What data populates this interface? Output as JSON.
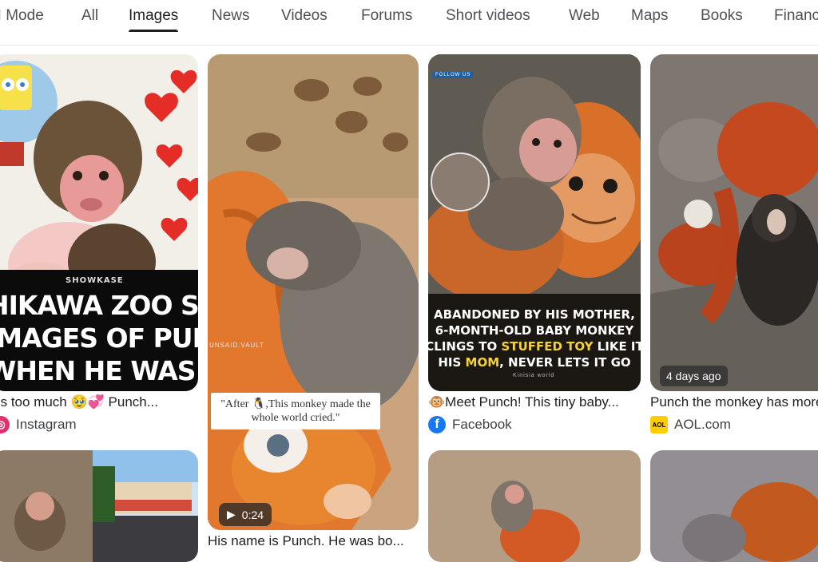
{
  "tabs": [
    {
      "label": "AI Mode",
      "active": false
    },
    {
      "label": "All",
      "active": false
    },
    {
      "label": "Images",
      "active": true
    },
    {
      "label": "News",
      "active": false
    },
    {
      "label": "Videos",
      "active": false
    },
    {
      "label": "Forums",
      "active": false
    },
    {
      "label": "Short videos",
      "active": false
    },
    {
      "label": "Web",
      "active": false
    },
    {
      "label": "Maps",
      "active": false
    },
    {
      "label": "Books",
      "active": false
    },
    {
      "label": "Finance",
      "active": false
    }
  ],
  "results": {
    "instagram": {
      "headline_line1": "HIKAWA ZOO SHARES",
      "headline_line2": "IMAGES OF PUNCH",
      "headline_line3": "WHEN HE WAS A BABY",
      "brand": "SHOWKASE",
      "caption": "This is too much 🥹💞 Punch...",
      "source": "Instagram"
    },
    "tiktok": {
      "quote": "\"After 🐧,This monkey made the whole world cried.\"",
      "watermark": "UNSAID.VAULT",
      "duration": "0:24",
      "caption": "His name is Punch. He was bo..."
    },
    "facebook": {
      "tag": "FOLLOW US",
      "line1": "ABANDONED BY HIS MOTHER,",
      "line2": "6-MONTH-OLD BABY MONKEY",
      "line3_a": "CLINGS TO ",
      "line3_hl": "STUFFED TOY",
      "line3_b": " LIKE IT",
      "line4_a": "HIS ",
      "line4_hl": "MOM",
      "line4_b": ", NEVER LETS IT GO",
      "signature": "Kinisia world",
      "caption": "🐵Meet Punch! This tiny baby...",
      "source": "Facebook"
    },
    "aol": {
      "age": "4 days ago",
      "caption": "Punch the monkey has more",
      "source": "AOL.com",
      "source_icon_text": "AOL"
    }
  },
  "colors": {
    "instagram_icon": "#e1306c",
    "facebook_icon": "#1877f2",
    "aol_icon": "#ffcc00",
    "tab_active_underline": "#1f1f1f"
  }
}
